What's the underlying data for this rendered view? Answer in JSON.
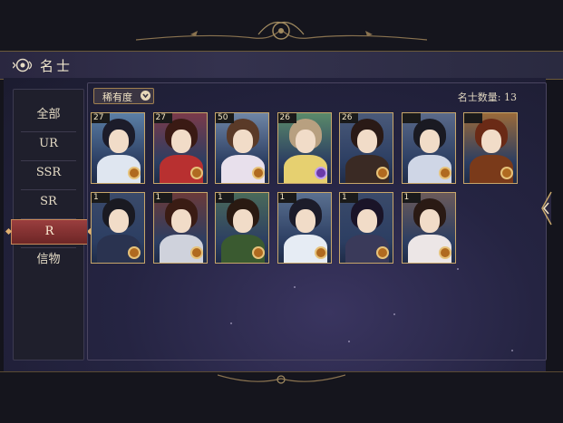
{
  "header": {
    "title": "名士"
  },
  "sidebar": {
    "items": [
      {
        "label": "全部"
      },
      {
        "label": "UR"
      },
      {
        "label": "SSR"
      },
      {
        "label": "SR"
      },
      {
        "label": "R"
      },
      {
        "label": "信物"
      }
    ],
    "active": "R"
  },
  "toolbar": {
    "filter_label": "稀有度",
    "count_text": "名士数量: 13"
  },
  "cards": [
    {
      "level": "27",
      "gem": "orange"
    },
    {
      "level": "27",
      "gem": "orange"
    },
    {
      "level": "50",
      "gem": "orange"
    },
    {
      "level": "26",
      "gem": "purple"
    },
    {
      "level": "26",
      "gem": "orange"
    },
    {
      "level": "",
      "gem": "orange"
    },
    {
      "level": "",
      "gem": "orange"
    },
    {
      "level": "1",
      "gem": "orange"
    },
    {
      "level": "1",
      "gem": "orange"
    },
    {
      "level": "1",
      "gem": "orange"
    },
    {
      "level": "1",
      "gem": "orange"
    },
    {
      "level": "1",
      "gem": "orange"
    },
    {
      "level": "1",
      "gem": "orange"
    }
  ],
  "colors": {
    "accent_gold": "#c7a66a",
    "active_tab": "#8a3535",
    "panel": "#252442"
  }
}
